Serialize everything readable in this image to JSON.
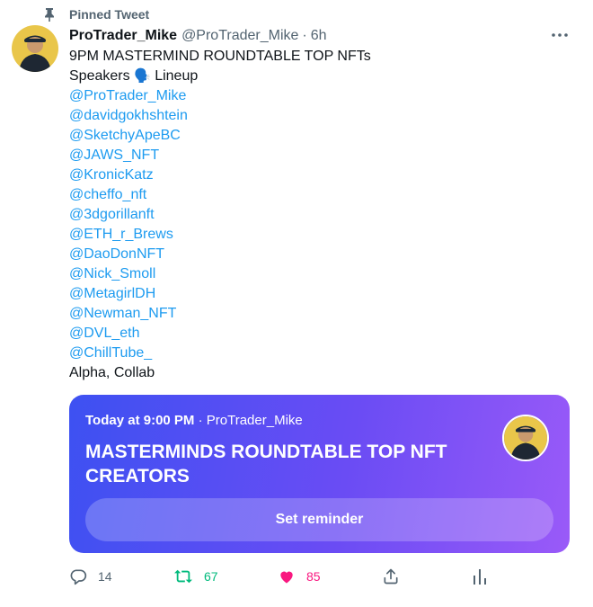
{
  "pinned": {
    "label": "Pinned Tweet",
    "icon": "pin-icon"
  },
  "author": {
    "display_name": "ProTrader_Mike",
    "handle": "@ProTrader_Mike",
    "separator": "·",
    "time": "6h"
  },
  "tweet": {
    "line1": "9PM MASTERMIND ROUNDTABLE TOP NFTs",
    "speakers_prefix": "Speakers",
    "speakers_emoji": "🗣️",
    "speakers_suffix": "Lineup",
    "mentions": [
      "@ProTrader_Mike",
      "@davidgokhshtein",
      "@SketchyApeBC",
      "@JAWS_NFT",
      "@KronicKatz",
      "@cheffo_nft",
      "@3dgorillanft",
      "@ETH_r_Brews",
      "@DaoDonNFT",
      "@Nick_Smoll",
      "@MetagirlDH",
      "@Newman_NFT",
      "@DVL_eth",
      "@ChillTube_"
    ],
    "closing": "Alpha, Collab"
  },
  "space_card": {
    "when": "Today at 9:00 PM",
    "separator": "·",
    "host": "ProTrader_Mike",
    "title": "MASTERMINDS ROUNDTABLE TOP NFT CREATORS",
    "button_label": "Set reminder",
    "gradient_start": "#3d51f2",
    "gradient_end": "#9a5af8"
  },
  "actions": {
    "replies": "14",
    "retweets": "67",
    "likes": "85",
    "retweet_color": "#00ba7c",
    "like_color": "#f91880"
  }
}
